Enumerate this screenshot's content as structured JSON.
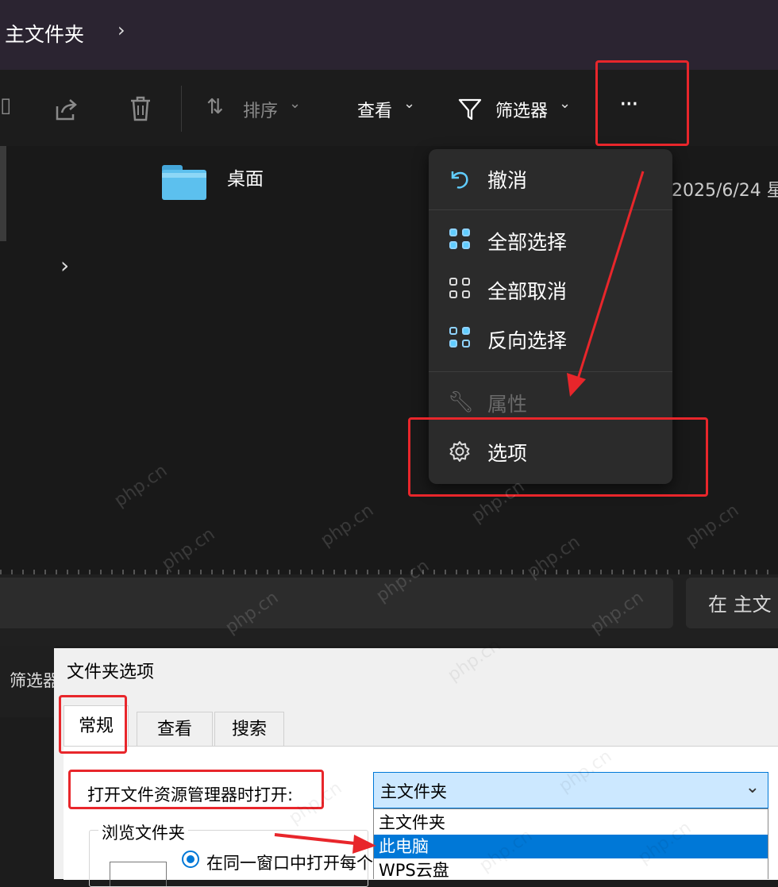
{
  "title_bar": {
    "breadcrumb": "主文件夹",
    "chevron": "›"
  },
  "toolbar": {
    "sort_label": "排序",
    "view_label": "查看",
    "filter_label": "筛选器",
    "more_label": "···",
    "dropdown_caret": "⌄"
  },
  "file_list": {
    "items": [
      {
        "name": "桌面",
        "date": "2025/6/24 星"
      }
    ],
    "expand_chevron": "›"
  },
  "more_menu": {
    "items": [
      {
        "label": "撤消",
        "icon": "undo-icon",
        "enabled": true
      },
      {
        "label": "全部选择",
        "icon": "select-all-icon",
        "enabled": true
      },
      {
        "label": "全部取消",
        "icon": "select-none-icon",
        "enabled": true
      },
      {
        "label": "反向选择",
        "icon": "invert-selection-icon",
        "enabled": true
      },
      {
        "label": "属性",
        "icon": "wrench-icon",
        "enabled": false
      },
      {
        "label": "选项",
        "icon": "gear-icon",
        "enabled": true
      }
    ]
  },
  "bottom_strip": {
    "search_right_text": "在 主文",
    "filter_partial": "筛选器"
  },
  "folder_options": {
    "title": "文件夹选项",
    "tabs": [
      {
        "label": "常规",
        "active": true
      },
      {
        "label": "查看",
        "active": false
      },
      {
        "label": "搜索",
        "active": false
      }
    ],
    "open_label": "打开文件资源管理器时打开:",
    "open_selected": "主文件夹",
    "open_options": [
      "主文件夹",
      "此电脑",
      "WPS云盘"
    ],
    "highlighted_option": "此电脑",
    "browse_group_label": "浏览文件夹",
    "browse_radio_label": "在同一窗口中打开每个"
  },
  "watermark": "php.cn",
  "colors": {
    "annotation_red": "#e8262b",
    "accent_blue": "#60cdff",
    "select_blue": "#0078d7"
  }
}
